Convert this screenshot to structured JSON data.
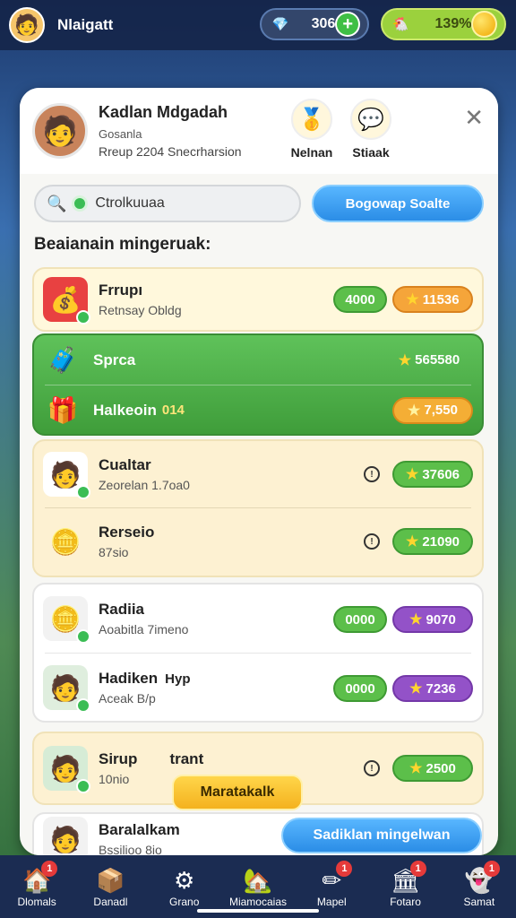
{
  "topbar": {
    "name": "Nlaigatt",
    "gems": "306",
    "coins": "139%"
  },
  "profile": {
    "name": "Kadlan Mdgadah",
    "sub": "Gosanla",
    "sub2": "Rreup 2204 Snecrharsion",
    "btn1": "Nelnan",
    "btn2": "Stiaak"
  },
  "search": {
    "value": "Ctrolkuuaa",
    "button": "Bogowap Soalte"
  },
  "section_title": "Beaianain mingeruak:",
  "rows": [
    {
      "title": "Frrupı",
      "sub": "Retnsay  Obldg",
      "left": "4000",
      "right": "11536"
    },
    {
      "title": "Sprca",
      "right": "565580"
    },
    {
      "title": "Halkeoin",
      "extra": "014",
      "right": "7,550"
    },
    {
      "title": "Cualtar",
      "sub": "Zeorelan  1.7oa0",
      "right": "37606"
    },
    {
      "title": "Rerseio",
      "sub": "87sio",
      "right": "21090"
    },
    {
      "title": "Radiia",
      "sub": "Aoabitla  7imeno",
      "left": "0000",
      "right": "9070"
    },
    {
      "title": "Hadiken",
      "extra": "Hyp",
      "sub": "Aceak  B/p",
      "left": "0000",
      "right": "7236"
    },
    {
      "title": "Sirup",
      "extra": "trant",
      "sub": "10nio",
      "right": "2500"
    },
    {
      "title": "Baralalkam",
      "sub": "Bssilioo  8io"
    }
  ],
  "tooltip_button": "Maratakalk",
  "bottom_button": "Sadiklan mingelwan",
  "nav": [
    "Dlomals",
    "Danadl",
    "Grano",
    "Miamocaias",
    "Mapel",
    "Fotaro",
    "Samat"
  ]
}
